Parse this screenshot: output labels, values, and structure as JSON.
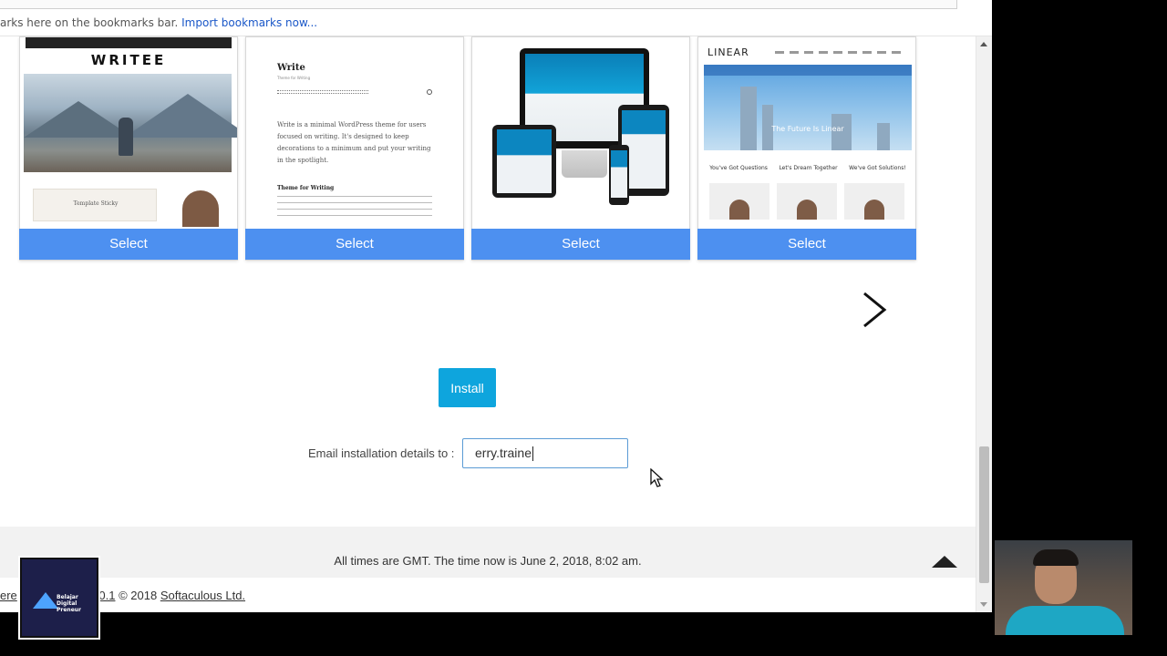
{
  "browser": {
    "bookmarks_message": "arks here on the bookmarks bar.",
    "import_link": "Import bookmarks now..."
  },
  "themes": [
    {
      "name": "WRITEE",
      "hero_caption": "",
      "footer_caption": "Template Sticky",
      "select_label": "Select"
    },
    {
      "name": "Write",
      "tagline": "Theme for Writing",
      "description": "Write is a minimal WordPress theme for users focused on writing. It's designed to keep decorations to a minimum and put your writing in the spotlight.",
      "post_heading": "Theme for Writing",
      "select_label": "Select"
    },
    {
      "name": "",
      "select_label": "Select"
    },
    {
      "name": "LINEAR",
      "hero_caption": "The Future Is Linear",
      "labels": [
        "You've Got Questions",
        "Let's Dream Together",
        "We've Got Solutions!"
      ],
      "select_label": "Select"
    }
  ],
  "carousel": {
    "next_icon": "chevron-right-icon"
  },
  "install": {
    "label": "Install"
  },
  "email": {
    "label": "Email installation details to :",
    "value": "erry.traine"
  },
  "footer": {
    "time_text": "All times are GMT. The time now is June 2, 2018, 8:02 am.",
    "copyright_prefix": "ere",
    "softaculous_version": "us 5.0.1",
    "copyright_mid": " © 2018 ",
    "company": "Softaculous Ltd."
  },
  "overlay": {
    "brand": "Belajar\nDigital\nPreneur"
  },
  "colors": {
    "select_button": "#4d90f0",
    "install_button": "#0ea5dd",
    "input_border": "#5b9bd5",
    "link": "#1a57c8"
  }
}
